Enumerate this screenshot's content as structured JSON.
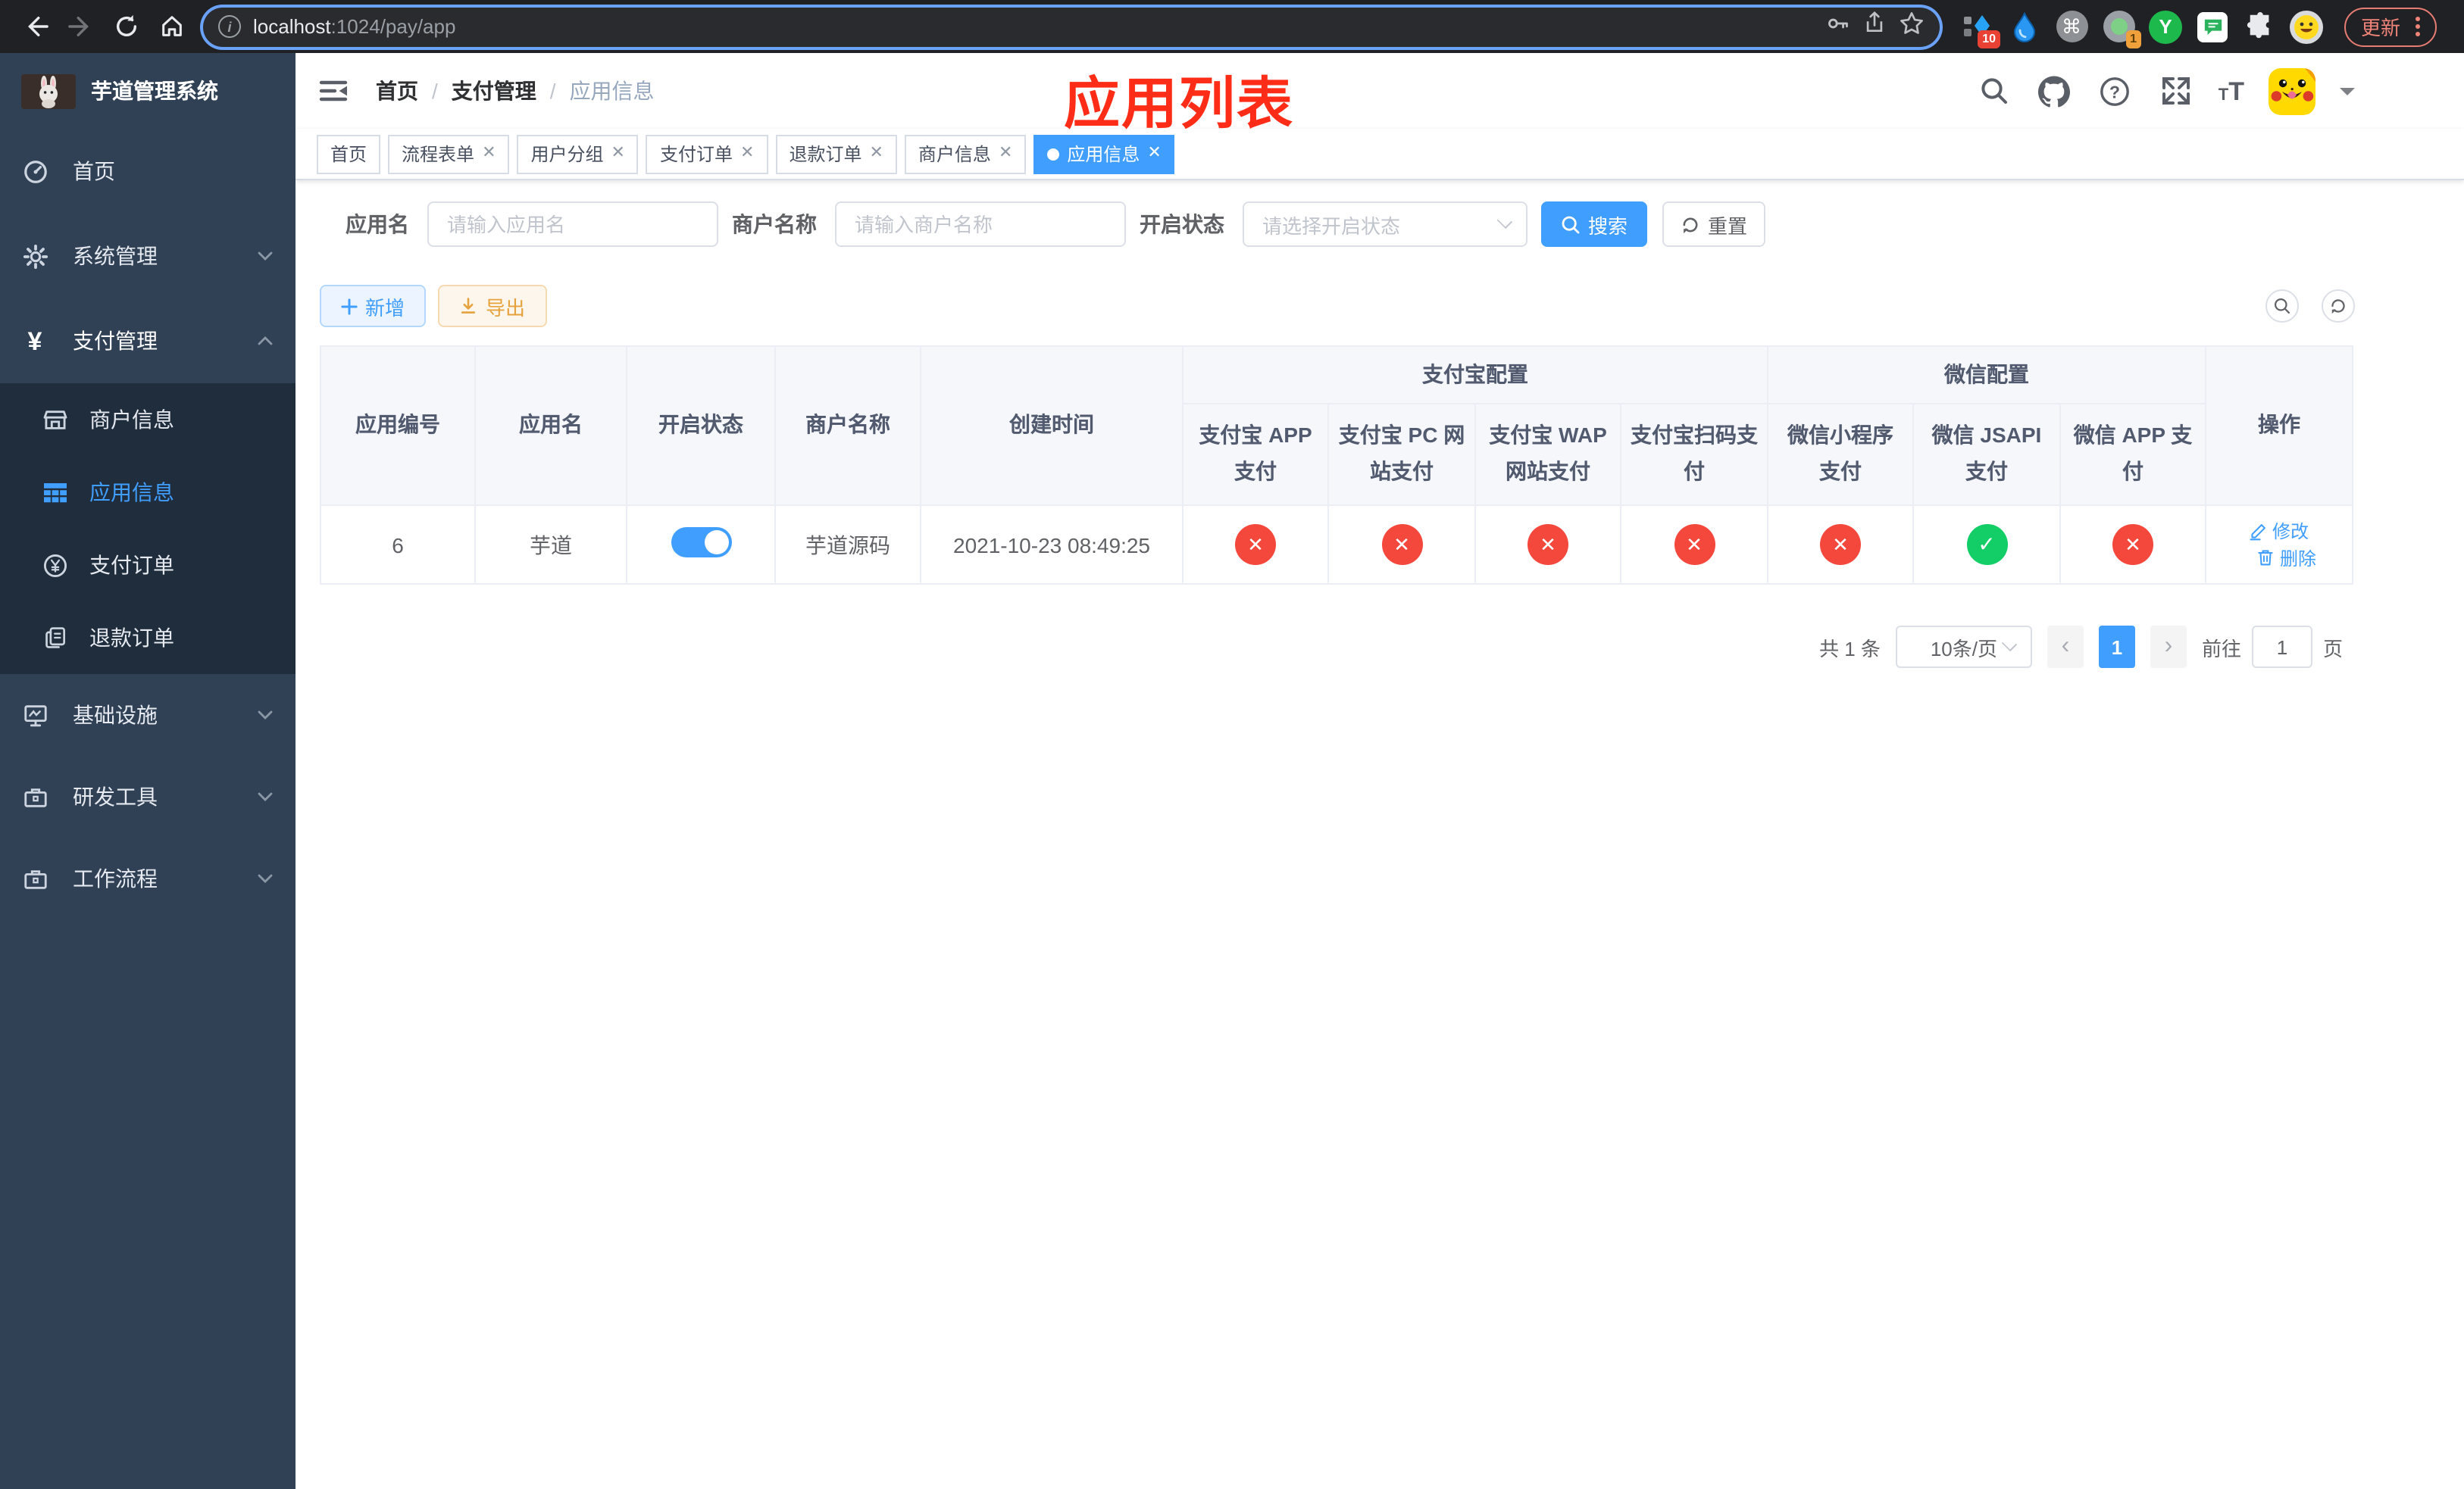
{
  "colors": {
    "accent": "#409eff",
    "success": "#13ce66",
    "danger": "#f5483d",
    "warning": "#e6a23c",
    "sidebar_bg": "#304156",
    "submenu_bg": "#1f2d3d",
    "annotation_red": "#ff2d17"
  },
  "browser": {
    "url_host": "localhost",
    "url_rest": ":1024/pay/app",
    "update_label": "更新",
    "ext_badge_10": "10",
    "ext_badge_1": "1"
  },
  "annotation": {
    "title": "应用列表"
  },
  "sidebar": {
    "app_title": "芋道管理系统",
    "items": [
      {
        "label": "首页",
        "icon": "dashboard-icon"
      },
      {
        "label": "系统管理",
        "icon": "gear-icon"
      },
      {
        "label": "支付管理",
        "icon": "yen-icon"
      },
      {
        "label": "基础设施",
        "icon": "monitor-icon"
      },
      {
        "label": "研发工具",
        "icon": "toolbox-icon"
      },
      {
        "label": "工作流程",
        "icon": "workflow-icon"
      }
    ],
    "submenu": [
      {
        "label": "商户信息",
        "icon": "shop-icon"
      },
      {
        "label": "应用信息",
        "icon": "grid-icon",
        "active": true
      },
      {
        "label": "支付订单",
        "icon": "yen-circle-icon"
      },
      {
        "label": "退款订单",
        "icon": "document-icon"
      }
    ]
  },
  "breadcrumb": {
    "a": "首页",
    "b": "支付管理",
    "c": "应用信息"
  },
  "tabs": [
    {
      "label": "首页",
      "closable": false,
      "active": false
    },
    {
      "label": "流程表单",
      "closable": true,
      "active": false
    },
    {
      "label": "用户分组",
      "closable": true,
      "active": false
    },
    {
      "label": "支付订单",
      "closable": true,
      "active": false
    },
    {
      "label": "退款订单",
      "closable": true,
      "active": false
    },
    {
      "label": "商户信息",
      "closable": true,
      "active": false
    },
    {
      "label": "应用信息",
      "closable": true,
      "active": true
    }
  ],
  "filters": {
    "app_name_label": "应用名",
    "app_name_placeholder": "请输入应用名",
    "merchant_label": "商户名称",
    "merchant_placeholder": "请输入商户名称",
    "status_label": "开启状态",
    "status_placeholder": "请选择开启状态",
    "search_label": "搜索",
    "reset_label": "重置"
  },
  "toolbar": {
    "add_label": "新增",
    "export_label": "导出"
  },
  "table": {
    "col_id": "应用编号",
    "col_name": "应用名",
    "col_status": "开启状态",
    "col_merchant": "商户名称",
    "col_created": "创建时间",
    "group_alipay": "支付宝配置",
    "group_wechat": "微信配置",
    "col_alipay_app": "支付宝 APP 支付",
    "col_alipay_pc": "支付宝 PC 网站支付",
    "col_alipay_wap": "支付宝 WAP 网站支付",
    "col_alipay_qr": "支付宝扫码支付",
    "col_wx_lite": "微信小程序支付",
    "col_wx_jsapi": "微信 JSAPI 支付",
    "col_wx_app": "微信 APP 支付",
    "col_ops": "操作",
    "row": {
      "id": "6",
      "name": "芋道",
      "enabled": true,
      "merchant": "芋道源码",
      "created_at": "2021-10-23 08:49:25",
      "channels": [
        {
          "name": "alipay-app",
          "enabled": false
        },
        {
          "name": "alipay-pc",
          "enabled": false
        },
        {
          "name": "alipay-wap",
          "enabled": false
        },
        {
          "name": "alipay-qr",
          "enabled": false
        },
        {
          "name": "wechat-lite",
          "enabled": false
        },
        {
          "name": "wechat-jsapi",
          "enabled": true
        },
        {
          "name": "wechat-app",
          "enabled": false
        }
      ],
      "edit_label": "修改",
      "delete_label": "删除"
    }
  },
  "pagination": {
    "total": "共 1 条",
    "page_size": "10条/页",
    "page": "1",
    "goto_label": "前往",
    "goto_value": "1",
    "unit_label": "页"
  }
}
